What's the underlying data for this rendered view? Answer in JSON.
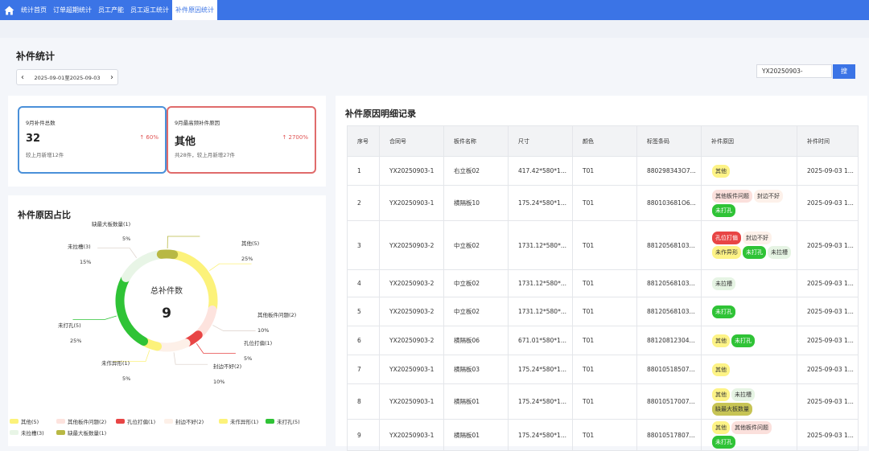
{
  "nav": {
    "tabs": [
      {
        "label": "统计首页"
      },
      {
        "label": "订单超期统计"
      },
      {
        "label": "员工产能"
      },
      {
        "label": "员工返工统计"
      },
      {
        "label": "补件原因统计"
      }
    ],
    "active_index": 4,
    "accent": "#3b74e6"
  },
  "page": {
    "title": "补件统计",
    "date_range": "2025-09-01至2025-09-03"
  },
  "search": {
    "value": "YX20250903-",
    "button_label": "搜"
  },
  "stats": {
    "total": {
      "label": "9月补件总数",
      "value": "32",
      "change": "↑ 60%",
      "sub": "较上月新增12件",
      "border_color": "#4a90d9"
    },
    "top_reason": {
      "label": "9月最高频补件原因",
      "value": "其他",
      "change": "↑ 2700%",
      "sub": "共28件，较上月新增27件",
      "border_color": "#e06b6b"
    }
  },
  "pie": {
    "title": "补件原因占比",
    "center_title": "总补件数",
    "center_value": "9"
  },
  "chart_data": {
    "type": "pie",
    "title": "补件原因占比",
    "slices": [
      {
        "name": "其他",
        "count": 5,
        "percent": "25%",
        "color": "#fcf27a"
      },
      {
        "name": "其他板件问题",
        "count": 2,
        "percent": "10%",
        "color": "#fde3de"
      },
      {
        "name": "孔位打偏",
        "count": 1,
        "percent": "5%",
        "color": "#e84545"
      },
      {
        "name": "封边不好",
        "count": 2,
        "percent": "10%",
        "color": "#fdf0e8"
      },
      {
        "name": "未作异形",
        "count": 1,
        "percent": "5%",
        "color": "#fcf27a"
      },
      {
        "name": "未打孔",
        "count": 5,
        "percent": "25%",
        "color": "#2fc336"
      },
      {
        "name": "未拉槽",
        "count": 3,
        "percent": "15%",
        "color": "#e8f5e6"
      },
      {
        "name": "缺最大板数量",
        "count": 1,
        "percent": "5%",
        "color": "#b8b844"
      }
    ],
    "total": 9
  },
  "legend": {
    "row1": [
      "其他(5)",
      "其他板件问题(2)",
      "孔位打偏(1)",
      "封边不好(2)",
      "未作异形(1)",
      "未打孔(5)"
    ],
    "row2": [
      "未拉槽(3)",
      "缺最大板数量(1)"
    ]
  },
  "detail": {
    "title": "补件原因明细记录",
    "columns": [
      "序号",
      "合同号",
      "板件名称",
      "尺寸",
      "颜色",
      "标签条码",
      "补件原因",
      "补件时间"
    ],
    "rows": [
      {
        "no": "1",
        "contract": "YX20250903-1",
        "name": "右立板02",
        "size": "417.42*580*1...",
        "color": "T01",
        "barcode": "880298343O7...",
        "tags": [
          {
            "t": "其他",
            "k": "yellow"
          }
        ],
        "time": "2025-09-03 1..."
      },
      {
        "no": "2",
        "contract": "YX20250903-1",
        "name": "横隔板10",
        "size": "175.24*580*1...",
        "color": "T01",
        "barcode": "880103681O6...",
        "tags": [
          {
            "t": "其他板件问题",
            "k": "pink"
          },
          {
            "t": "封边不好",
            "k": "cream"
          },
          {
            "t": "未打孔",
            "k": "green"
          }
        ],
        "time": "2025-09-03 1..."
      },
      {
        "no": "3",
        "contract": "YX20250903-2",
        "name": "中立板02",
        "size": "1731.12*580*...",
        "color": "T01",
        "barcode": "88120568103...",
        "tags": [
          {
            "t": "孔位打偏",
            "k": "red"
          },
          {
            "t": "封边不好",
            "k": "cream"
          },
          {
            "t": "未作异形",
            "k": "yellow"
          },
          {
            "t": "未打孔",
            "k": "green"
          },
          {
            "t": "未拉槽",
            "k": "lightgreen"
          }
        ],
        "time": "2025-09-03 1..."
      },
      {
        "no": "4",
        "contract": "YX20250903-2",
        "name": "中立板02",
        "size": "1731.12*580*...",
        "color": "T01",
        "barcode": "88120568103...",
        "tags": [
          {
            "t": "未拉槽",
            "k": "lightgreen"
          }
        ],
        "time": "2025-09-03 1..."
      },
      {
        "no": "5",
        "contract": "YX20250903-2",
        "name": "中立板02",
        "size": "1731.12*580*...",
        "color": "T01",
        "barcode": "88120568103...",
        "tags": [
          {
            "t": "未打孔",
            "k": "green"
          }
        ],
        "time": "2025-09-03 1..."
      },
      {
        "no": "6",
        "contract": "YX20250903-2",
        "name": "横隔板06",
        "size": "671.01*580*1...",
        "color": "T01",
        "barcode": "88120812304...",
        "tags": [
          {
            "t": "其他",
            "k": "yellow"
          },
          {
            "t": "未打孔",
            "k": "green"
          }
        ],
        "time": "2025-09-03 1..."
      },
      {
        "no": "7",
        "contract": "YX20250903-1",
        "name": "横隔板03",
        "size": "175.24*580*1...",
        "color": "T01",
        "barcode": "88010518507...",
        "tags": [
          {
            "t": "其他",
            "k": "yellow"
          }
        ],
        "time": "2025-09-03 1..."
      },
      {
        "no": "8",
        "contract": "YX20250903-1",
        "name": "横隔板01",
        "size": "175.24*580*1...",
        "color": "T01",
        "barcode": "88010517007...",
        "tags": [
          {
            "t": "其他",
            "k": "yellow"
          },
          {
            "t": "未拉槽",
            "k": "lightgreen"
          },
          {
            "t": "缺最大板数量",
            "k": "olive"
          }
        ],
        "time": "2025-09-03 1..."
      },
      {
        "no": "9",
        "contract": "YX20250903-1",
        "name": "横隔板01",
        "size": "175.24*580*1...",
        "color": "T01",
        "barcode": "88010517807...",
        "tags": [
          {
            "t": "其他",
            "k": "yellow"
          },
          {
            "t": "其他板件问题",
            "k": "pink"
          },
          {
            "t": "未打孔",
            "k": "green"
          }
        ],
        "time": "2025-09-03 1..."
      }
    ]
  },
  "tag_colors": {
    "yellow": {
      "bg": "#fdf386",
      "fg": "#333333"
    },
    "pink": {
      "bg": "#fbe0dc",
      "fg": "#333333"
    },
    "cream": {
      "bg": "#fdf1ea",
      "fg": "#333333"
    },
    "green": {
      "bg": "#2fc336",
      "fg": "#ffffff"
    },
    "red": {
      "bg": "#e84545",
      "fg": "#ffffff"
    },
    "lightgreen": {
      "bg": "#e6f4e4",
      "fg": "#333333"
    },
    "olive": {
      "bg": "#c7c455",
      "fg": "#333333"
    }
  }
}
